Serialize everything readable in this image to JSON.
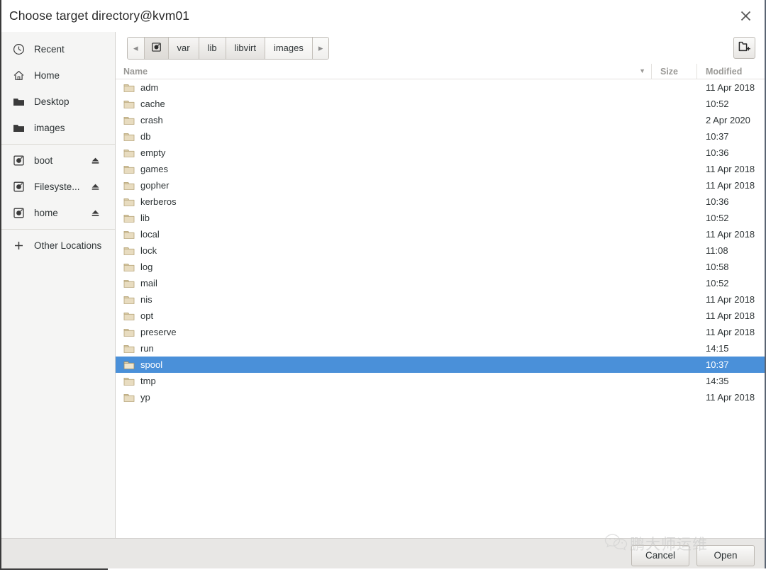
{
  "window": {
    "title": "Choose target directory@kvm01",
    "close_icon": "close-icon"
  },
  "sidebar": {
    "groups": [
      {
        "items": [
          {
            "label": "Recent",
            "icon": "clock-icon",
            "eject": false
          },
          {
            "label": "Home",
            "icon": "home-icon",
            "eject": false
          },
          {
            "label": "Desktop",
            "icon": "folder-icon",
            "eject": false
          },
          {
            "label": "images",
            "icon": "folder-icon",
            "eject": false
          }
        ]
      },
      {
        "items": [
          {
            "label": "boot",
            "icon": "drive-icon",
            "eject": true
          },
          {
            "label": "Filesyste...",
            "icon": "drive-icon",
            "eject": true
          },
          {
            "label": "home",
            "icon": "drive-icon",
            "eject": true
          }
        ]
      },
      {
        "items": [
          {
            "label": "Other Locations",
            "icon": "plus-icon",
            "eject": false
          }
        ]
      }
    ]
  },
  "pathbar": {
    "prev_arrow": "◂",
    "next_arrow": "▸",
    "root_icon": "drive-icon",
    "crumbs": [
      "var",
      "lib",
      "libvirt",
      "images"
    ],
    "new_folder_icon": "new-folder-icon"
  },
  "columns": {
    "name": "Name",
    "size": "Size",
    "modified": "Modified",
    "sort_caret": "▼"
  },
  "files": [
    {
      "name": "adm",
      "size": "",
      "modified": "11 Apr 2018",
      "selected": false
    },
    {
      "name": "cache",
      "size": "",
      "modified": "10:52",
      "selected": false
    },
    {
      "name": "crash",
      "size": "",
      "modified": "2 Apr 2020",
      "selected": false
    },
    {
      "name": "db",
      "size": "",
      "modified": "10:37",
      "selected": false
    },
    {
      "name": "empty",
      "size": "",
      "modified": "10:36",
      "selected": false
    },
    {
      "name": "games",
      "size": "",
      "modified": "11 Apr 2018",
      "selected": false
    },
    {
      "name": "gopher",
      "size": "",
      "modified": "11 Apr 2018",
      "selected": false
    },
    {
      "name": "kerberos",
      "size": "",
      "modified": "10:36",
      "selected": false
    },
    {
      "name": "lib",
      "size": "",
      "modified": "10:52",
      "selected": false
    },
    {
      "name": "local",
      "size": "",
      "modified": "11 Apr 2018",
      "selected": false
    },
    {
      "name": "lock",
      "size": "",
      "modified": "11:08",
      "selected": false
    },
    {
      "name": "log",
      "size": "",
      "modified": "10:58",
      "selected": false
    },
    {
      "name": "mail",
      "size": "",
      "modified": "10:52",
      "selected": false
    },
    {
      "name": "nis",
      "size": "",
      "modified": "11 Apr 2018",
      "selected": false
    },
    {
      "name": "opt",
      "size": "",
      "modified": "11 Apr 2018",
      "selected": false
    },
    {
      "name": "preserve",
      "size": "",
      "modified": "11 Apr 2018",
      "selected": false
    },
    {
      "name": "run",
      "size": "",
      "modified": "14:15",
      "selected": false
    },
    {
      "name": "spool",
      "size": "",
      "modified": "10:37",
      "selected": true
    },
    {
      "name": "tmp",
      "size": "",
      "modified": "14:35",
      "selected": false
    },
    {
      "name": "yp",
      "size": "",
      "modified": "11 Apr 2018",
      "selected": false
    }
  ],
  "footer": {
    "cancel": "Cancel",
    "open": "Open"
  },
  "watermark": {
    "text": "鹏大师运维",
    "icon": "wechat-icon"
  },
  "colors": {
    "selection": "#4a90d9",
    "highlight_box": "#e8696e",
    "sidebar_bg": "#f5f5f4",
    "footer_bg": "#e8e7e5"
  }
}
